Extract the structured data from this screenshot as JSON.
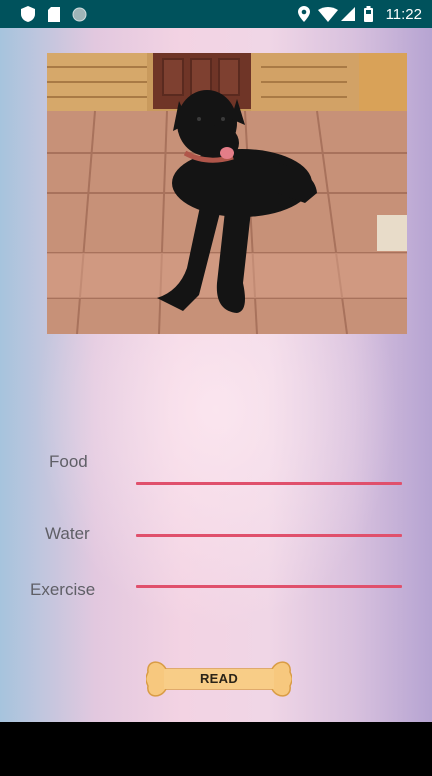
{
  "status_bar": {
    "time": "11:22",
    "left_icons": [
      "shield-icon",
      "sd-card-icon",
      "circle-notification-icon"
    ],
    "right_icons": [
      "location-pin-icon",
      "wifi-icon",
      "cell-signal-icon",
      "battery-icon"
    ],
    "background": "#00525c"
  },
  "photo": {
    "subject": "black-dog"
  },
  "form": {
    "rows": [
      {
        "label": "Food",
        "value": ""
      },
      {
        "label": "Water",
        "value": ""
      },
      {
        "label": "Exercise",
        "value": ""
      }
    ],
    "underline_color": "#e0506c"
  },
  "read_button": {
    "label": "READ",
    "icon": "bone-icon",
    "color": "#f7c87e"
  }
}
